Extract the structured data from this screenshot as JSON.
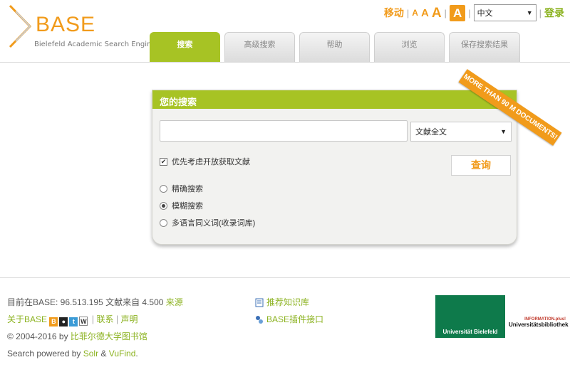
{
  "logo": {
    "name": "BASE",
    "subtitle": "Bielefeld Academic Search Engine"
  },
  "topbar": {
    "mobile": "移动",
    "font_small": "A",
    "font_medium": "A",
    "font_large": "A",
    "font_active": "A",
    "language": "中文",
    "login": "登录"
  },
  "tabs": [
    {
      "label": "搜索"
    },
    {
      "label": "高级搜索"
    },
    {
      "label": "帮助"
    },
    {
      "label": "浏览"
    },
    {
      "label": "保存搜索结果"
    }
  ],
  "search": {
    "heading": "您的搜索",
    "query_value": "",
    "field_select": "文献全文",
    "open_access_label": "优先考虑开放获取文献",
    "button": "查询",
    "options": [
      {
        "label": "精确搜索",
        "selected": false
      },
      {
        "label": "模糊搜索",
        "selected": true
      },
      {
        "label": "多语言同义词(收录词库)",
        "selected": false
      }
    ]
  },
  "ribbon": "MORE THAN 90 M DOCUMENTS!",
  "footer": {
    "stats_prefix": "目前在BASE: 96.513.195 文献来自 4.500",
    "stats_link": "来源",
    "about": "关于BASE",
    "contact": "联系",
    "statement": "声明",
    "copyright": "© 2004-2016 by",
    "library_link": "比菲尔德大学图书馆",
    "powered_prefix": "Search powered by",
    "solr": "Solr",
    "amp": "&",
    "vufind": "VuFind",
    "period": ".",
    "recommend": "推荐知识库",
    "plugin": "BASE插件接口",
    "uni_logo_text": "Universität Bielefeld",
    "unibib_small": "INFORMATION.plus!",
    "unibib_big": "Universitätsbibliothek"
  },
  "colors": {
    "accent_green": "#a7c324",
    "accent_orange": "#f19b1b"
  }
}
